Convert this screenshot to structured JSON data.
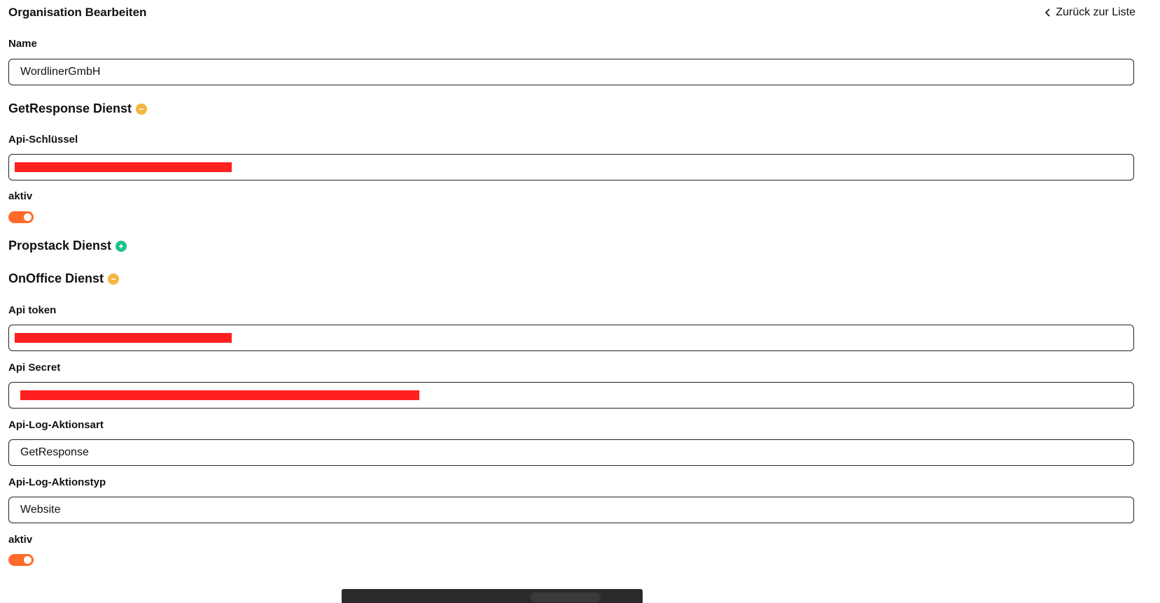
{
  "header": {
    "title": "Organisation Bearbeiten",
    "back_label": "Zurück zur Liste"
  },
  "name": {
    "label": "Name",
    "value": "WordlinerGmbH"
  },
  "getresponse": {
    "section_title": "GetResponse Dienst",
    "api_key_label": "Api-Schlüssel",
    "active_label": "aktiv",
    "active": true
  },
  "propstack": {
    "section_title": "Propstack Dienst"
  },
  "onoffice": {
    "section_title": "OnOffice Dienst",
    "api_token_label": "Api token",
    "api_secret_label": "Api Secret",
    "log_action_kind_label": "Api-Log-Aktionsart",
    "log_action_kind_value": "GetResponse",
    "log_action_type_label": "Api-Log-Aktionstyp",
    "log_action_type_value": "Website",
    "active_label": "aktiv",
    "active": true
  },
  "colors": {
    "accent": "#ff6a2a",
    "minus": "#f4b63e",
    "plus": "#1ec28b",
    "redaction": "#ff2020"
  }
}
